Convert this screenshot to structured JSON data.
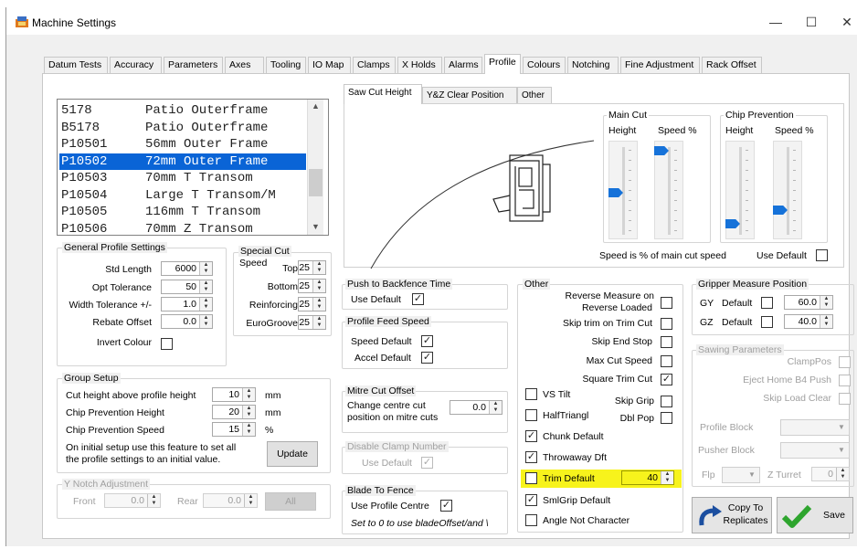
{
  "window": {
    "title": "Machine Settings",
    "minimize": "—",
    "maximize": "☐",
    "close": "✕"
  },
  "tabs": [
    "Datum Tests",
    "Accuracy",
    "Parameters",
    "Axes",
    "Tooling",
    "IO Map",
    "Clamps",
    "X Holds",
    "Alarms",
    "Profile",
    "Colours",
    "Notching",
    "Fine Adjustment",
    "Rack Offset"
  ],
  "active_tab": "Profile",
  "profiles": [
    {
      "code": "5178",
      "name": "Patio Outerframe"
    },
    {
      "code": "B5178",
      "name": "Patio Outerframe"
    },
    {
      "code": "P10501",
      "name": "56mm Outer Frame"
    },
    {
      "code": "P10502",
      "name": "72mm Outer Frame"
    },
    {
      "code": "P10503",
      "name": "70mm T Transom"
    },
    {
      "code": "P10504",
      "name": "Large T Transom/M"
    },
    {
      "code": "P10505",
      "name": "116mm T Transom"
    },
    {
      "code": "P10506",
      "name": "70mm Z Transom"
    }
  ],
  "selected_profile": "P10502",
  "general": {
    "title": "General Profile Settings",
    "std_length_label": "Std Length",
    "std_length": "6000",
    "opt_tolerance_label": "Opt Tolerance",
    "opt_tolerance": "50",
    "width_tolerance_label": "Width Tolerance +/-",
    "width_tolerance": "1.0",
    "rebate_offset_label": "Rebate Offset",
    "rebate_offset": "0.0",
    "invert_colour_label": "Invert Colour"
  },
  "special_cut": {
    "title": "Special Cut",
    "speed_label": "Speed",
    "top_label": "Top",
    "top": "25",
    "bottom_label": "Bottom",
    "bottom": "25",
    "reinforcing_label": "Reinforcing",
    "reinforcing": "25",
    "eurogroove_label": "EuroGroove",
    "eurogroove": "25"
  },
  "group_setup": {
    "title": "Group Setup",
    "cut_height_label": "Cut height above profile height",
    "cut_height": "10",
    "cut_height_unit": "mm",
    "chip_height_label": "Chip Prevention Height",
    "chip_height": "20",
    "chip_height_unit": "mm",
    "chip_speed_label": "Chip Prevention Speed",
    "chip_speed": "15",
    "chip_speed_unit": "%",
    "note_line1": "On initial setup use this feature to set all",
    "note_line2": "the profile settings to an initial value.",
    "update_label": "Update"
  },
  "y_notch": {
    "title": "Y Notch Adjustment",
    "front_label": "Front",
    "front": "0.0",
    "rear_label": "Rear",
    "rear": "0.0",
    "all_label": "All"
  },
  "subtabs": [
    "Saw Cut Height",
    "Y&Z Clear Position",
    "Other"
  ],
  "main_cut": {
    "title": "Main Cut",
    "height_label": "Height",
    "speed_label": "Speed %"
  },
  "chip_prevention": {
    "title": "Chip Prevention",
    "height_label": "Height",
    "speed_label": "Speed %"
  },
  "speed_note": "Speed is % of main cut speed",
  "use_default_label": "Use Default",
  "push_backfence": {
    "title": "Push to Backfence Time",
    "use_default_label": "Use Default"
  },
  "profile_feed": {
    "title": "Profile Feed Speed",
    "speed_default_label": "Speed Default",
    "accel_default_label": "Accel Default"
  },
  "mitre": {
    "title": "Mitre Cut Offset",
    "line1": "Change centre cut",
    "line2": "position on mitre cuts",
    "value": "0.0"
  },
  "disable_clamp": {
    "title": "Disable Clamp Number",
    "use_default_label": "Use Default"
  },
  "blade_fence": {
    "title": "Blade To Fence",
    "use_profile_centre_label": "Use Profile Centre",
    "note": "Set to 0 to use bladeOffset/and \\"
  },
  "other": {
    "title": "Other",
    "reverse_measure_line1": "Reverse Measure on",
    "reverse_measure_line2": "Reverse Loaded",
    "skip_trim_label": "Skip trim on Trim Cut",
    "skip_end_stop_label": "Skip End Stop",
    "max_cut_speed_label": "Max Cut Speed",
    "square_trim_label": "Square Trim Cut",
    "vs_tilt_label": "VS Tilt",
    "skip_grip_label": "Skip Grip",
    "half_triangl_label": "HalfTriangl",
    "dbl_pop_label": "Dbl Pop",
    "chunk_default_label": "Chunk Default",
    "throwaway_label": "Throwaway Dft",
    "trim_default_label": "Trim Default",
    "trim_default_value": "40",
    "smlgrip_label": "SmlGrip Default",
    "angle_label": "Angle Not Character"
  },
  "gripper": {
    "title": "Gripper Measure Position",
    "gy_label": "GY",
    "gy_default_label": "Default",
    "gy_value": "60.0",
    "gz_label": "GZ",
    "gz_default_label": "Default",
    "gz_value": "40.0"
  },
  "sawing": {
    "title": "Sawing Parameters",
    "clamppos_label": "ClampPos",
    "eject_label": "Eject Home B4 Push",
    "skip_load_label": "Skip Load Clear",
    "profile_block_label": "Profile Block",
    "pusher_block_label": "Pusher Block",
    "flip_label": "Flp",
    "z_turret_label": "Z Turret",
    "z_turret_value": "0"
  },
  "copy_label_line1": "Copy To",
  "copy_label_line2": "Replicates",
  "save_label": "Save",
  "colors": {
    "selection": "#0a64d6",
    "slider_thumb": "#1672d9",
    "highlight": "#f7f31c",
    "save_check": "#2ea52e"
  }
}
